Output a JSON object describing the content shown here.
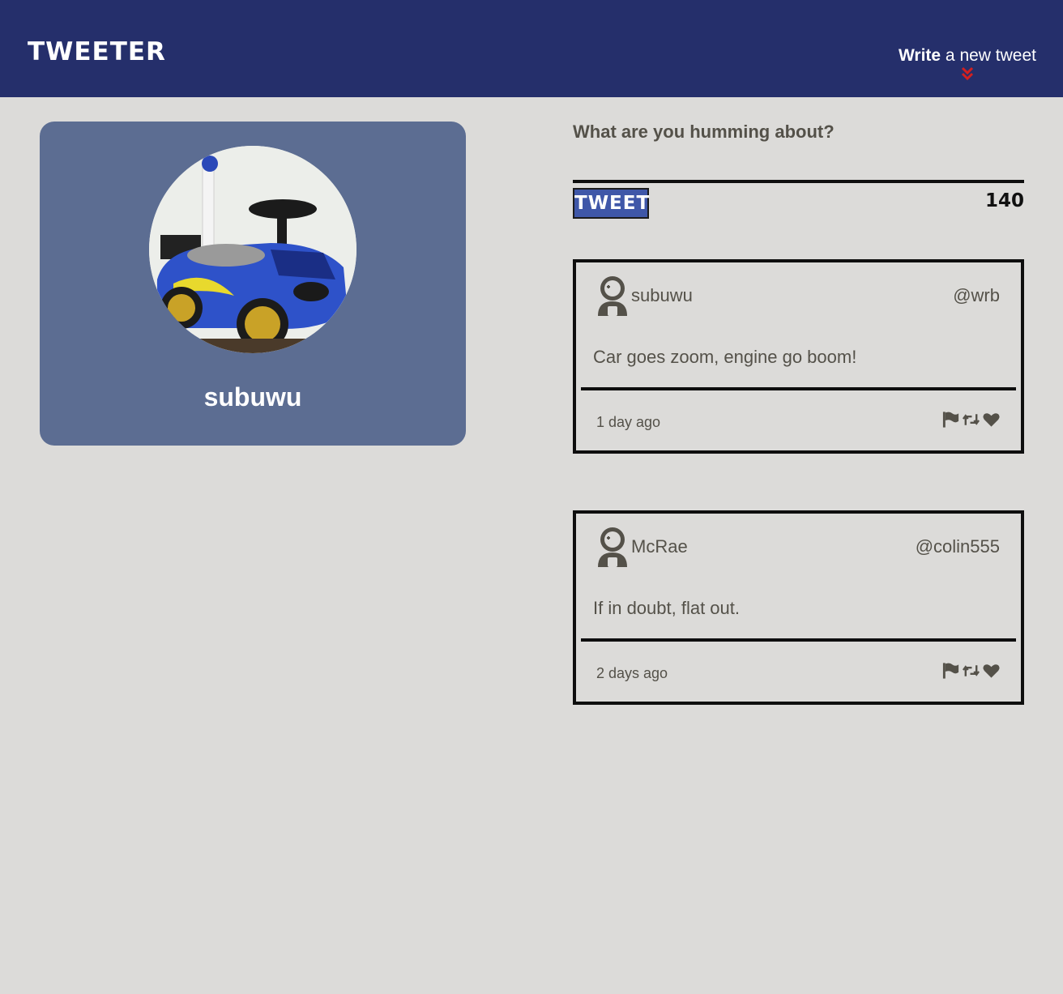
{
  "header": {
    "brand": "TWEETER",
    "compose_link_strong": "Write",
    "compose_link_rest": " a new tweet",
    "bg_color": "#252f6b",
    "arrow_color": "#d22020"
  },
  "profile": {
    "name": "subuwu",
    "card_color": "#5c6d92"
  },
  "composer": {
    "prompt": "What are you humming about?",
    "button_label": "TWEET",
    "char_counter": "140"
  },
  "tweets": [
    {
      "name": "subuwu",
      "handle": "@wrb",
      "content": "Car goes zoom, engine go boom!",
      "time": "1 day ago",
      "icons": [
        "flag-icon",
        "retweet-icon",
        "heart-icon"
      ]
    },
    {
      "name": "McRae",
      "handle": "@colin555",
      "content": "If in doubt, flat out.",
      "time": "2 days ago",
      "icons": [
        "flag-icon",
        "retweet-icon",
        "heart-icon"
      ]
    }
  ]
}
